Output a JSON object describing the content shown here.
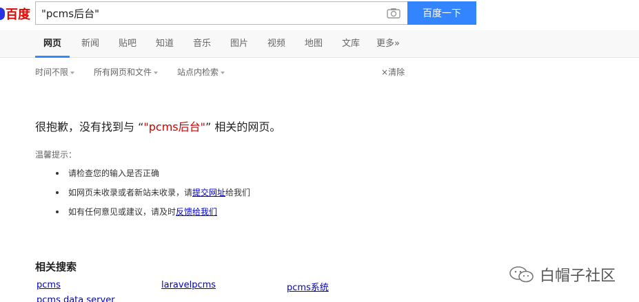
{
  "header": {
    "logo_text": "百度",
    "search_value": "\"pcms后台\"",
    "search_button": "百度一下"
  },
  "tabs": [
    {
      "label": "网页",
      "active": true
    },
    {
      "label": "新闻"
    },
    {
      "label": "贴吧"
    },
    {
      "label": "知道"
    },
    {
      "label": "音乐"
    },
    {
      "label": "图片"
    },
    {
      "label": "视频"
    },
    {
      "label": "地图"
    },
    {
      "label": "文库"
    },
    {
      "label": "更多»"
    }
  ],
  "filters": {
    "time": "时间不限",
    "filetype": "所有网页和文件",
    "site": "站点内检索",
    "clear": "清除"
  },
  "no_result": {
    "prefix": "很抱歉，没有找到与 “",
    "query": "\"pcms后台\"",
    "suffix": "” 相关的网页。"
  },
  "tips": {
    "title": "温馨提示：",
    "item1": "请检查您的输入是否正确",
    "item2_prefix": "如网页未收录或者新站未收录，请",
    "item2_link": "提交网址",
    "item2_suffix": "给我们",
    "item3_prefix": "如有任何意见或建议，请及时",
    "item3_link": "反馈给我们"
  },
  "related": {
    "title": "相关搜索",
    "items": [
      "pcms",
      "laravelpcms",
      "pcms系统",
      "pcms data server"
    ]
  },
  "watermark": {
    "text": "白帽子社区"
  }
}
